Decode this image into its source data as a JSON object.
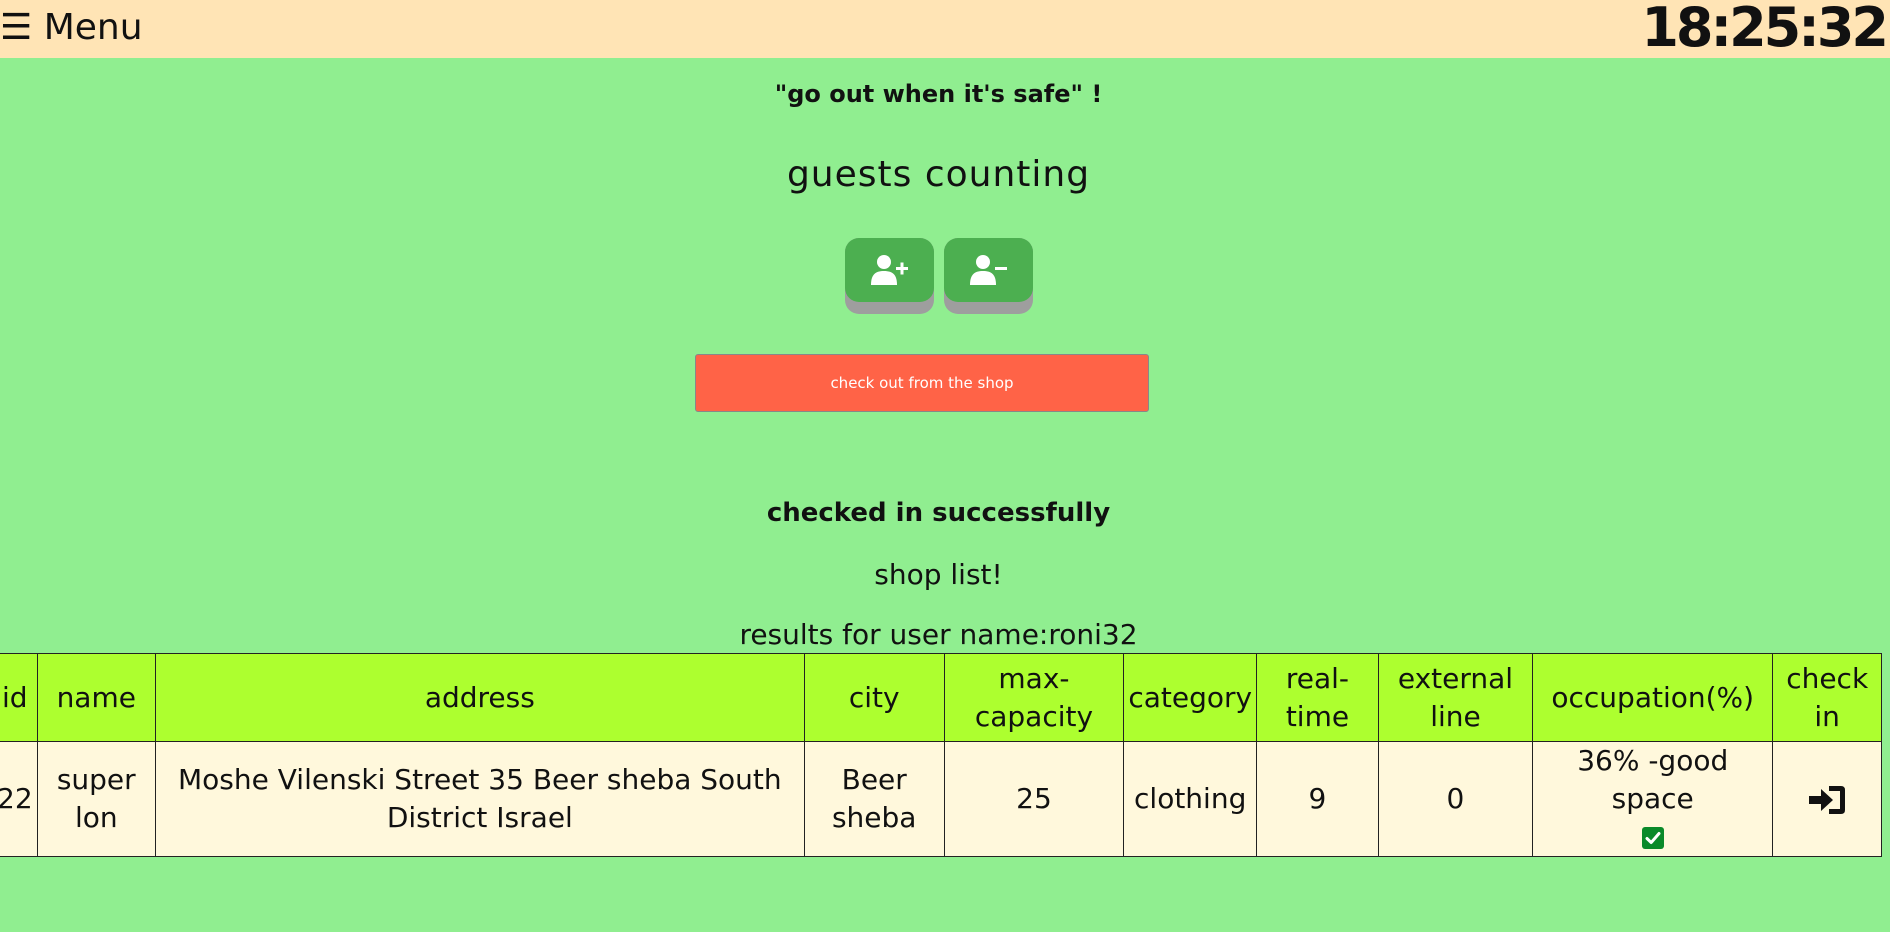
{
  "topbar": {
    "menu_label": "☰ Menu",
    "clock": "18:25:32"
  },
  "slogan": "\"go out when it's safe\" !",
  "heading": "guests counting",
  "buttons": {
    "add_guest_icon": "user-plus-icon",
    "remove_guest_icon": "user-minus-icon"
  },
  "checkout_label": "check out from the shop",
  "status": "checked in successfully",
  "shop_list_title": "shop list!",
  "results_label": "results for user name:roni32",
  "table": {
    "headers": [
      "id",
      "name",
      "address",
      "city",
      "max-capacity",
      "category",
      "real-time",
      "external line",
      "occupation(%)",
      "check in"
    ],
    "rows": [
      {
        "id": "22",
        "name": "super lon",
        "address": "Moshe Vilenski Street 35 Beer sheba South District Israel",
        "city": "Beer sheba",
        "max_capacity": "25",
        "category": "clothing",
        "real_time": "9",
        "external_line": "0",
        "occupation": "36% -good space",
        "occupation_icon": "check-square-icon",
        "checkin_icon": "sign-in-icon"
      }
    ]
  },
  "colors": {
    "background": "#90ee90",
    "topbar": "#ffe4b5",
    "guest_button": "#4caf50",
    "checkout_button": "#ff6347",
    "table_header": "#adff2f",
    "table_row": "#fff8dc",
    "ok_badge": "#0a8a2a"
  }
}
